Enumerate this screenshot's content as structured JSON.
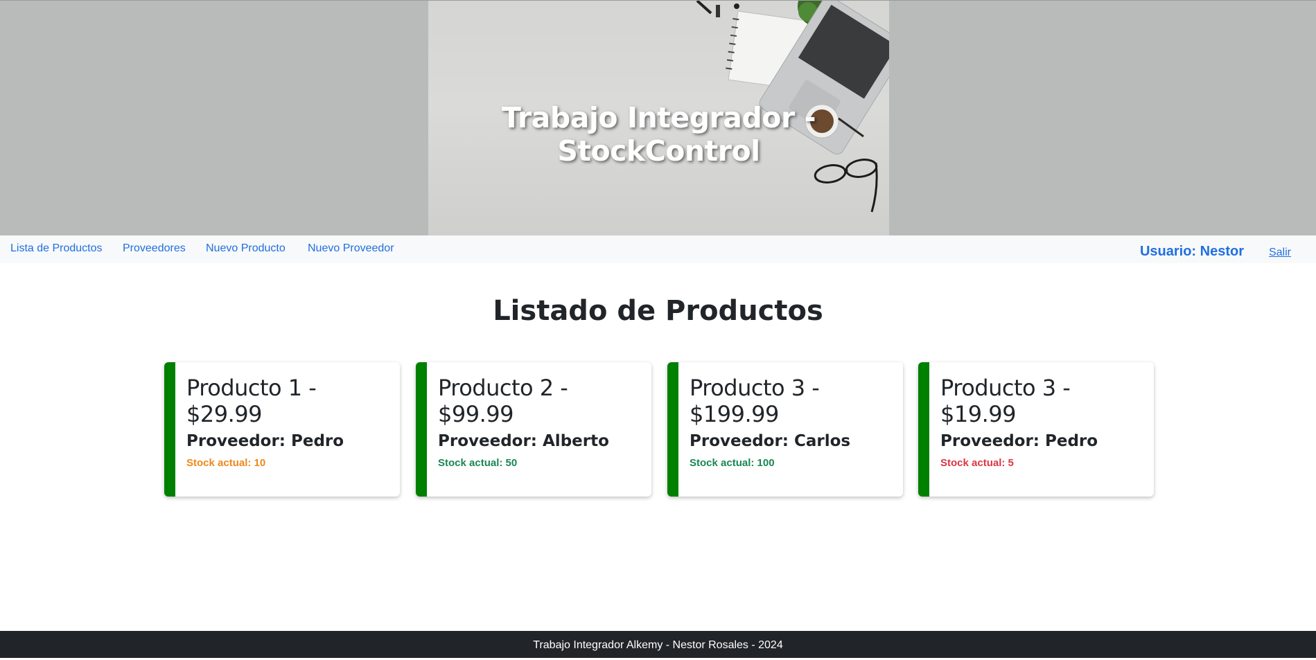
{
  "hero": {
    "title": "Trabajo Integrador - StockControl"
  },
  "nav": {
    "links": [
      {
        "label": "Lista de Productos"
      },
      {
        "label": "Proveedores"
      },
      {
        "label": "Nuevo Producto"
      },
      {
        "label": "Nuevo Proveedor"
      }
    ],
    "user": "Usuario: Nestor",
    "logout": "Salir"
  },
  "main": {
    "title": "Listado de Productos",
    "cards": [
      {
        "title": "Producto 1 - $29.99",
        "provider": "Proveedor: Pedro",
        "stock": "Stock actual: 10",
        "stock_color": "#f0871a"
      },
      {
        "title": "Producto 2 - $99.99",
        "provider": "Proveedor: Alberto",
        "stock": "Stock actual: 50",
        "stock_color": "#198754"
      },
      {
        "title": "Producto 3 - $199.99",
        "provider": "Proveedor: Carlos",
        "stock": "Stock actual: 100",
        "stock_color": "#198754"
      },
      {
        "title": "Producto 3 - $19.99",
        "provider": "Proveedor: Pedro",
        "stock": "Stock actual: 5",
        "stock_color": "#dc3545"
      }
    ]
  },
  "footer": {
    "text": "Trabajo Integrador Alkemy - Nestor Rosales - 2024"
  },
  "colors": {
    "accent": "#1f6fe0",
    "card_border": "#008000",
    "footer_bg": "#212529",
    "hero_bg": "#b9bbba"
  }
}
